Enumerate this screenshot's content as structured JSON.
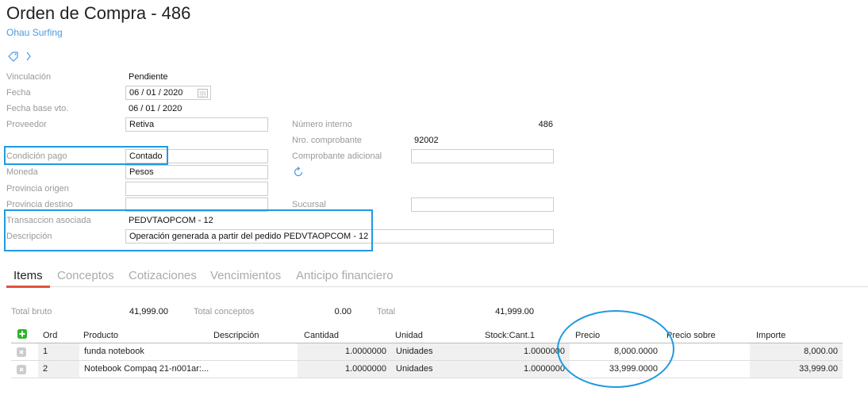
{
  "header": {
    "title": "Orden de Compra - 486",
    "subtitle": "Ohau Surfing"
  },
  "icons": {
    "tag": "tag-icon",
    "next": "chevron-right-icon",
    "calendar": "calendar-icon",
    "refresh": "refresh-icon",
    "add": "add-row-icon",
    "delete": "delete-row-icon"
  },
  "form": {
    "vinculacion": {
      "label": "Vinculación",
      "value": "Pendiente"
    },
    "fecha": {
      "label": "Fecha",
      "day": "06",
      "month": "01",
      "year": "2020"
    },
    "fecha_base": {
      "label": "Fecha base vto.",
      "day": "06",
      "month": "01",
      "year": "2020"
    },
    "proveedor": {
      "label": "Proveedor",
      "value": "Retiva"
    },
    "condicion": {
      "label": "Condición pago",
      "value": "Contado"
    },
    "moneda": {
      "label": "Moneda",
      "value": "Pesos"
    },
    "prov_origen": {
      "label": "Provincia origen",
      "value": ""
    },
    "prov_destino": {
      "label": "Provincia destino",
      "value": ""
    },
    "transaccion": {
      "label": "Transaccion asociada",
      "value": "PEDVTAOPCOM - 12"
    },
    "descripcion": {
      "label": "Descripción",
      "value": "Operación generada a partir del pedido PEDVTAOPCOM - 12"
    },
    "numero_interno": {
      "label": "Número interno",
      "value": "486"
    },
    "nro_comprobante": {
      "label": "Nro. comprobante",
      "value": "92002"
    },
    "comprobante_adicional": {
      "label": "Comprobante adicional",
      "value": ""
    },
    "sucursal": {
      "label": "Sucursal",
      "value": ""
    }
  },
  "tabs": [
    "Items",
    "Conceptos",
    "Cotizaciones",
    "Vencimientos",
    "Anticipo financiero"
  ],
  "active_tab": "Items",
  "totals": {
    "bruto_label": "Total bruto",
    "bruto": "41,999.00",
    "conceptos_label": "Total conceptos",
    "conceptos": "0.00",
    "total_label": "Total",
    "total": "41,999.00"
  },
  "table": {
    "headers": [
      "Ord",
      "Producto",
      "Descripción",
      "Cantidad",
      "Unidad",
      "Stock:Cant.1",
      "Precio",
      "Precio sobre",
      "Importe"
    ],
    "rows": [
      {
        "ord": "1",
        "producto": "funda notebook",
        "descripcion": "",
        "cantidad": "1.0000000",
        "unidad": "Unidades",
        "stock": "1.0000000",
        "precio": "8,000.0000",
        "precio_sobre": "",
        "importe": "8,000.00"
      },
      {
        "ord": "2",
        "producto": "Notebook Compaq 21-n001ar:...",
        "descripcion": "",
        "cantidad": "1.0000000",
        "unidad": "Unidades",
        "stock": "1.0000000",
        "precio": "33,999.0000",
        "precio_sobre": "",
        "importe": "33,999.00"
      }
    ]
  },
  "colors": {
    "accent": "#4a9be0",
    "highlight": "#1e9be0",
    "tab_underline": "#e0533c",
    "add": "#2bb52b"
  }
}
